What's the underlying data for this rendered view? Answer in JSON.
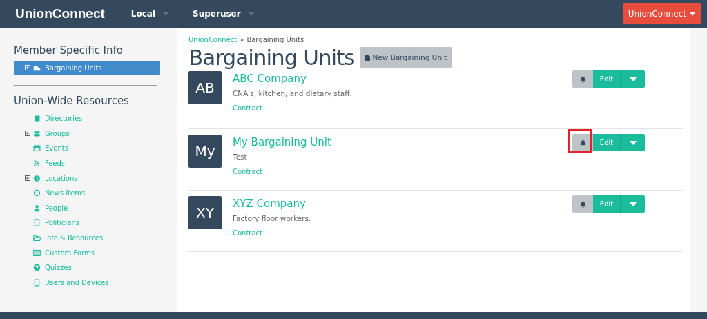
{
  "header": {
    "brand": "UnionConnect",
    "menus": [
      {
        "label": "Local"
      },
      {
        "label": "Superuser"
      }
    ],
    "account_button": "UnionConnect"
  },
  "sidebar": {
    "sections": [
      {
        "title": "Member Specific Info",
        "items": [
          {
            "label": "Bargaining Units",
            "expandable": true,
            "selected": true
          }
        ]
      },
      {
        "title": "Union-Wide Resources",
        "items": [
          {
            "label": "Directories",
            "expandable": false,
            "selected": false
          },
          {
            "label": "Groups",
            "expandable": true,
            "selected": false
          },
          {
            "label": "Events",
            "expandable": false,
            "selected": false
          },
          {
            "label": "Feeds",
            "expandable": false,
            "selected": false
          },
          {
            "label": "Locations",
            "expandable": true,
            "selected": false
          },
          {
            "label": "News Items",
            "expandable": false,
            "selected": false
          },
          {
            "label": "People",
            "expandable": false,
            "selected": false
          },
          {
            "label": "Politicians",
            "expandable": false,
            "selected": false
          },
          {
            "label": "Info & Resources",
            "expandable": false,
            "selected": false
          },
          {
            "label": "Custom Forms",
            "expandable": false,
            "selected": false
          },
          {
            "label": "Quizzes",
            "expandable": false,
            "selected": false
          },
          {
            "label": "Users and Devices",
            "expandable": false,
            "selected": false
          }
        ]
      }
    ]
  },
  "breadcrumb": [
    {
      "label": "UnionConnect",
      "link": true
    },
    {
      "label": "»",
      "link": false
    },
    {
      "label": "Bargaining Units",
      "link": false
    }
  ],
  "page_title": "Bargaining Units",
  "new_button": "New Bargaining Unit",
  "units": [
    {
      "initials": "AB",
      "name": "ABC Company",
      "description": "CNA's, kitchen, and dietary staff.",
      "link": "Contract",
      "edit": "Edit",
      "bell_highlighted": false
    },
    {
      "initials": "My",
      "name": "My Bargaining Unit",
      "description": "Test",
      "link": "Contract",
      "edit": "Edit",
      "bell_highlighted": true
    },
    {
      "initials": "XY",
      "name": "XYZ Company",
      "description": "Factory floor workers.",
      "link": "Contract",
      "edit": "Edit",
      "bell_highlighted": false
    }
  ]
}
